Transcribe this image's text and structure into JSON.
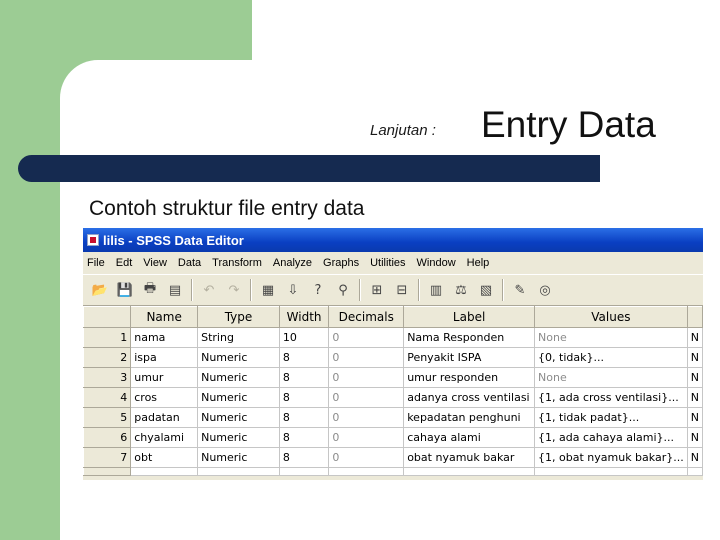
{
  "slide": {
    "subtitle": "Lanjutan :",
    "title": "Entry Data",
    "heading": "Contoh struktur file entry data"
  },
  "window": {
    "title": "lilis - SPSS Data Editor"
  },
  "menu": [
    "File",
    "Edt",
    "View",
    "Data",
    "Transform",
    "Analyze",
    "Graphs",
    "Utilities",
    "Window",
    "Help"
  ],
  "toolbar": [
    {
      "icon": "open-icon",
      "glyph": "📂"
    },
    {
      "icon": "save-icon",
      "glyph": "💾"
    },
    {
      "icon": "print-icon",
      "glyph": "🖶"
    },
    {
      "icon": "dialog-recall-icon",
      "glyph": "▤"
    },
    {
      "icon": "undo-icon",
      "glyph": "↶"
    },
    {
      "icon": "redo-icon",
      "glyph": "↷"
    },
    {
      "icon": "goto-chart-icon",
      "glyph": "▦"
    },
    {
      "icon": "goto-case-icon",
      "glyph": "⇩"
    },
    {
      "icon": "variables-icon",
      "glyph": "?"
    },
    {
      "icon": "find-icon",
      "glyph": "⚲"
    },
    {
      "icon": "insert-cases-icon",
      "glyph": "⊞"
    },
    {
      "icon": "insert-variable-icon",
      "glyph": "⊟"
    },
    {
      "icon": "split-file-icon",
      "glyph": "▥"
    },
    {
      "icon": "weight-cases-icon",
      "glyph": "⚖"
    },
    {
      "icon": "select-cases-icon",
      "glyph": "▧"
    },
    {
      "icon": "value-labels-icon",
      "glyph": "✎"
    },
    {
      "icon": "use-sets-icon",
      "glyph": "◎"
    }
  ],
  "grid": {
    "columns": [
      "Name",
      "Type",
      "Width",
      "Decimals",
      "Label",
      "Values"
    ],
    "rows": [
      {
        "num": "1",
        "name": "nama",
        "type": "String",
        "width": "10",
        "decimals": "0",
        "label": "Nama Responden",
        "values": "None",
        "extra": "N"
      },
      {
        "num": "2",
        "name": "ispa",
        "type": "Numeric",
        "width": "8",
        "decimals": "0",
        "label": "Penyakit ISPA",
        "values": "{0, tidak}...",
        "extra": "N"
      },
      {
        "num": "3",
        "name": "umur",
        "type": "Numeric",
        "width": "8",
        "decimals": "0",
        "label": "umur responden",
        "values": "None",
        "extra": "N"
      },
      {
        "num": "4",
        "name": "cros",
        "type": "Numeric",
        "width": "8",
        "decimals": "0",
        "label": "adanya cross ventilasi",
        "values": "{1, ada cross ventilasi}...",
        "extra": "N"
      },
      {
        "num": "5",
        "name": "padatan",
        "type": "Numeric",
        "width": "8",
        "decimals": "0",
        "label": "kepadatan penghuni",
        "values": "{1, tidak padat}...",
        "extra": "N"
      },
      {
        "num": "6",
        "name": "chyalami",
        "type": "Numeric",
        "width": "8",
        "decimals": "0",
        "label": "cahaya alami",
        "values": "{1, ada cahaya alami}...",
        "extra": "N"
      },
      {
        "num": "7",
        "name": "obt",
        "type": "Numeric",
        "width": "8",
        "decimals": "0",
        "label": "obat nyamuk bakar",
        "values": "{1, obat nyamuk bakar}...",
        "extra": "N"
      }
    ]
  },
  "colors": {
    "slide_green": "#9ccc94",
    "slide_navy": "#152a50",
    "titlebar_blue": "#0a3fc2"
  }
}
